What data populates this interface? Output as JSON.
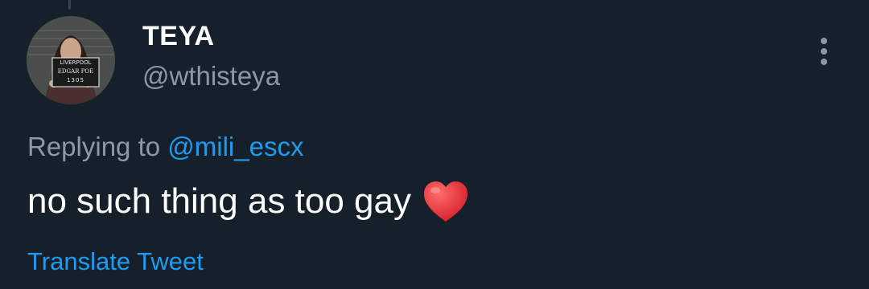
{
  "tweet": {
    "author": {
      "display_name": "TEYA",
      "handle": "@wthisteya",
      "avatar_sign": {
        "line1": "LIVERPOOL",
        "line2": "EDGAR POE",
        "line3": "1305"
      }
    },
    "reply": {
      "prefix": "Replying to",
      "mention": "@mili_escx"
    },
    "text": "no such thing as too gay",
    "emoji_icon": "red-heart-icon",
    "translate_label": "Translate Tweet",
    "more_icon": "more-vertical-icon"
  },
  "colors": {
    "background": "#15202b",
    "primary_text": "#ffffff",
    "secondary_text": "#8b98a5",
    "accent": "#1d9bf0",
    "heart": "#e0245e"
  }
}
